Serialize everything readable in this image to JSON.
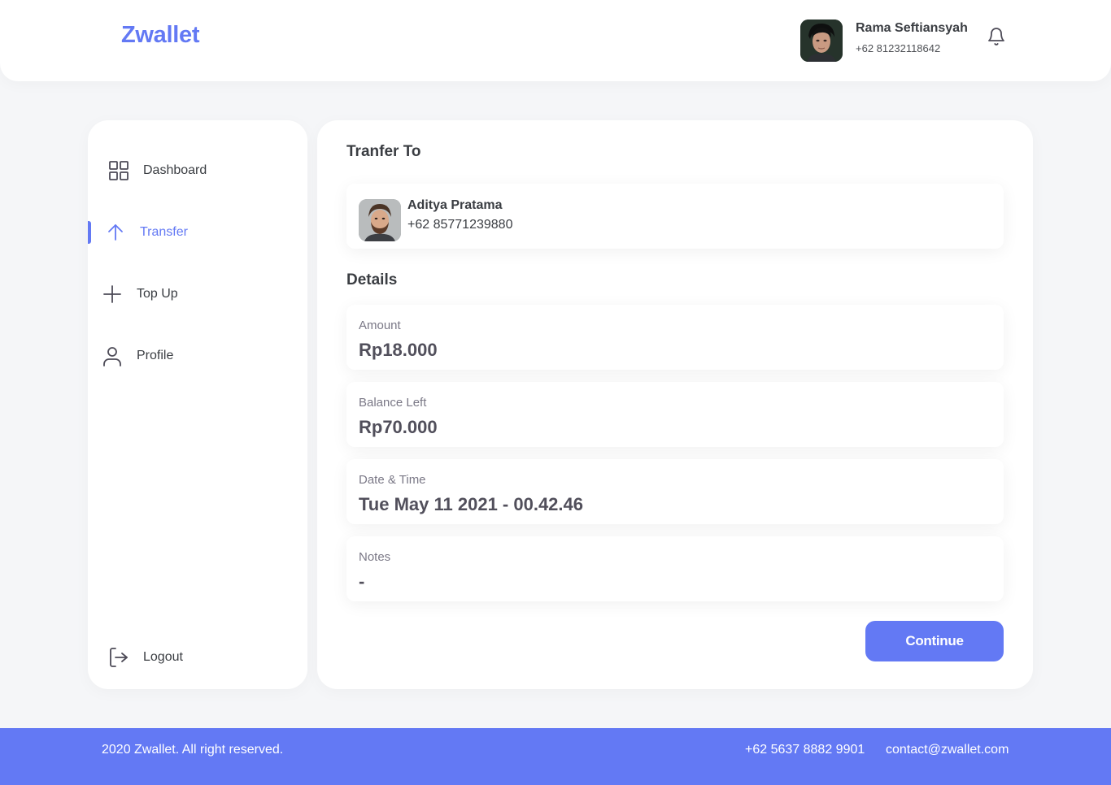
{
  "brand": "Zwallet",
  "user": {
    "name": "Rama Seftiansyah",
    "phone": "+62 81232118642"
  },
  "icons": {
    "notification": "bell-icon",
    "dashboard": "grid-icon",
    "transfer": "arrow-up-icon",
    "topup": "plus-icon",
    "profile": "user-icon",
    "logout": "logout-icon"
  },
  "sidebar": {
    "items": [
      {
        "label": "Dashboard",
        "active": false
      },
      {
        "label": "Transfer",
        "active": true
      },
      {
        "label": "Top Up",
        "active": false
      },
      {
        "label": "Profile",
        "active": false
      }
    ],
    "logout_label": "Logout"
  },
  "main": {
    "transfer_title": "Tranfer To",
    "recipient": {
      "name": "Aditya Pratama",
      "phone": "+62 85771239880"
    },
    "details_title": "Details",
    "details": [
      {
        "label": "Amount",
        "value": "Rp18.000"
      },
      {
        "label": "Balance Left",
        "value": "Rp70.000"
      },
      {
        "label": "Date & Time",
        "value": "Tue May 11 2021 - 00.42.46"
      },
      {
        "label": "Notes",
        "value": "-"
      }
    ],
    "continue_label": "Continue"
  },
  "footer": {
    "copyright": "2020 Zwallet. All right reserved.",
    "phone": "+62 5637 8882 9901",
    "email": "contact@zwallet.com"
  },
  "colors": {
    "accent": "#6379f4",
    "background": "#f5f6f8",
    "text": "#3a3d42"
  }
}
